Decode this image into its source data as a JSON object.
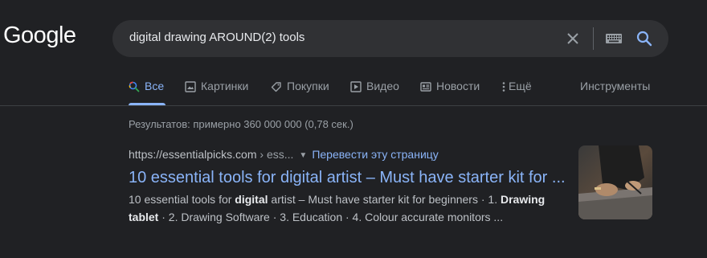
{
  "logo": {
    "text": "Google"
  },
  "search": {
    "query": "digital drawing AROUND(2) tools"
  },
  "tabs": [
    {
      "label": "Все",
      "icon": "search-icon",
      "active": true
    },
    {
      "label": "Картинки",
      "icon": "image-icon"
    },
    {
      "label": "Покупки",
      "icon": "tag-icon"
    },
    {
      "label": "Видео",
      "icon": "play-icon"
    },
    {
      "label": "Новости",
      "icon": "news-icon"
    },
    {
      "label": "Ещё",
      "icon": "more-vert-icon"
    }
  ],
  "tools_label": "Инструменты",
  "stats": "Результатов: примерно 360 000 000 (0,78 сек.)",
  "result": {
    "cite_domain": "https://essentialpicks.com",
    "cite_path": " › ess...",
    "translate_label": "Перевести эту страницу",
    "title": "10 essential tools for digital artist – Must have starter kit for ...",
    "snippet": {
      "part1": "10 essential tools for ",
      "bold1": "digital",
      "part2": " artist – Must have starter kit for beginners · 1. ",
      "bold2": "Drawing",
      "bold3": "tablet",
      "part3": " · 2. Drawing Software · 3. Education · 4. Colour accurate monitors ..."
    },
    "thumbnail": "person drawing on tablet photo"
  },
  "colors": {
    "background": "#202124",
    "link": "#8ab4f8",
    "text": "#bdc1c6"
  }
}
